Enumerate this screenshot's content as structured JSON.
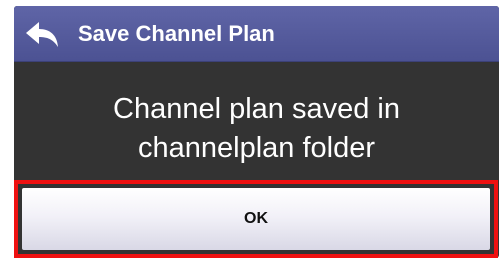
{
  "dialog": {
    "title": "Save Channel Plan",
    "back_icon": "back-arrow-icon",
    "message_lines": [
      "Channel plan saved in",
      "channelplan folder"
    ],
    "ok_label": "OK"
  },
  "colors": {
    "titlebar": "#5a5fa2",
    "body": "#333333",
    "highlight": "#ee1111",
    "button": "#eeedf5"
  }
}
